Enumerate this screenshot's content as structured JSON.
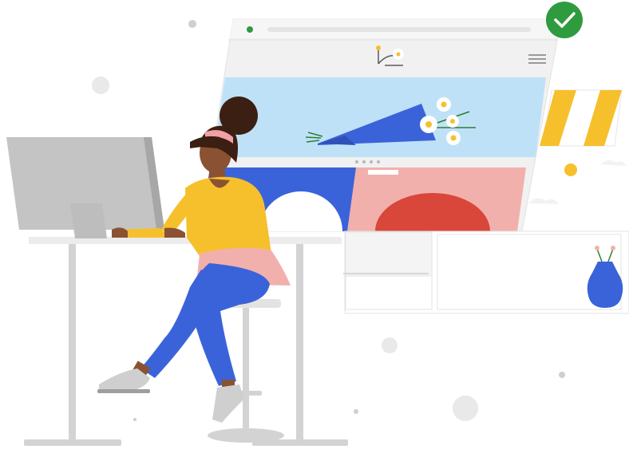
{
  "illustration": {
    "palette": {
      "blue": "#3b63d9",
      "light_blue": "#bfe1f7",
      "yellow": "#f6c02c",
      "pink": "#f2b0ad",
      "red": "#d9473a",
      "green": "#2e9b3e",
      "gray": "#c9c9c9",
      "skin": "#8a5232",
      "hair": "#3b1f12"
    },
    "icons": [
      "checkmark-icon",
      "logo-icon",
      "hamburger-menu-icon"
    ]
  }
}
